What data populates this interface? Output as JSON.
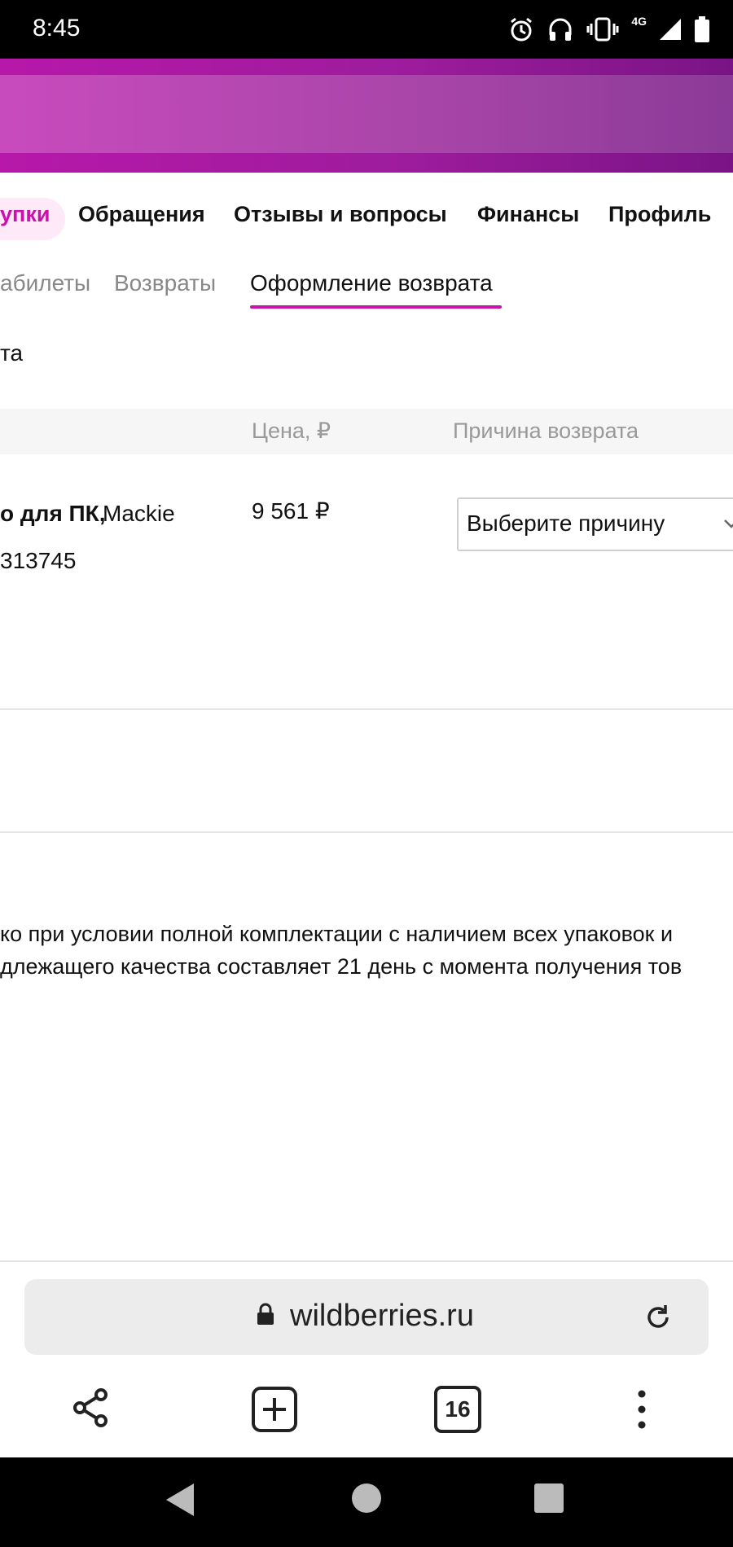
{
  "status_bar": {
    "time": "8:45",
    "network": "4G"
  },
  "main_tabs": [
    {
      "label": "упки"
    },
    {
      "label": "Обращения"
    },
    {
      "label": "Отзывы и вопросы"
    },
    {
      "label": "Финансы"
    },
    {
      "label": "Профиль"
    }
  ],
  "sub_tabs": [
    {
      "label": "абилеты"
    },
    {
      "label": "Возвраты"
    },
    {
      "label": "Оформление возврата"
    }
  ],
  "section_title_fragment": "та",
  "table": {
    "headers": {
      "price": "Цена, ₽",
      "reason": "Причина возврата"
    },
    "row": {
      "product_bold": "о для ПК,",
      "product_brand": "Mackie",
      "product_code": "313745",
      "price": "9 561 ₽",
      "reason_placeholder": "Выберите причину"
    }
  },
  "notice": {
    "line1": "ко при условии полной комплектации с наличием всех упаковок и",
    "line2": "длежащего качества составляет 21 день с момента получения тов"
  },
  "browser": {
    "url": "wildberries.ru",
    "tabs_count": "16"
  },
  "colors": {
    "accent": "#cb11ab",
    "banner": "#9d1c9d"
  }
}
